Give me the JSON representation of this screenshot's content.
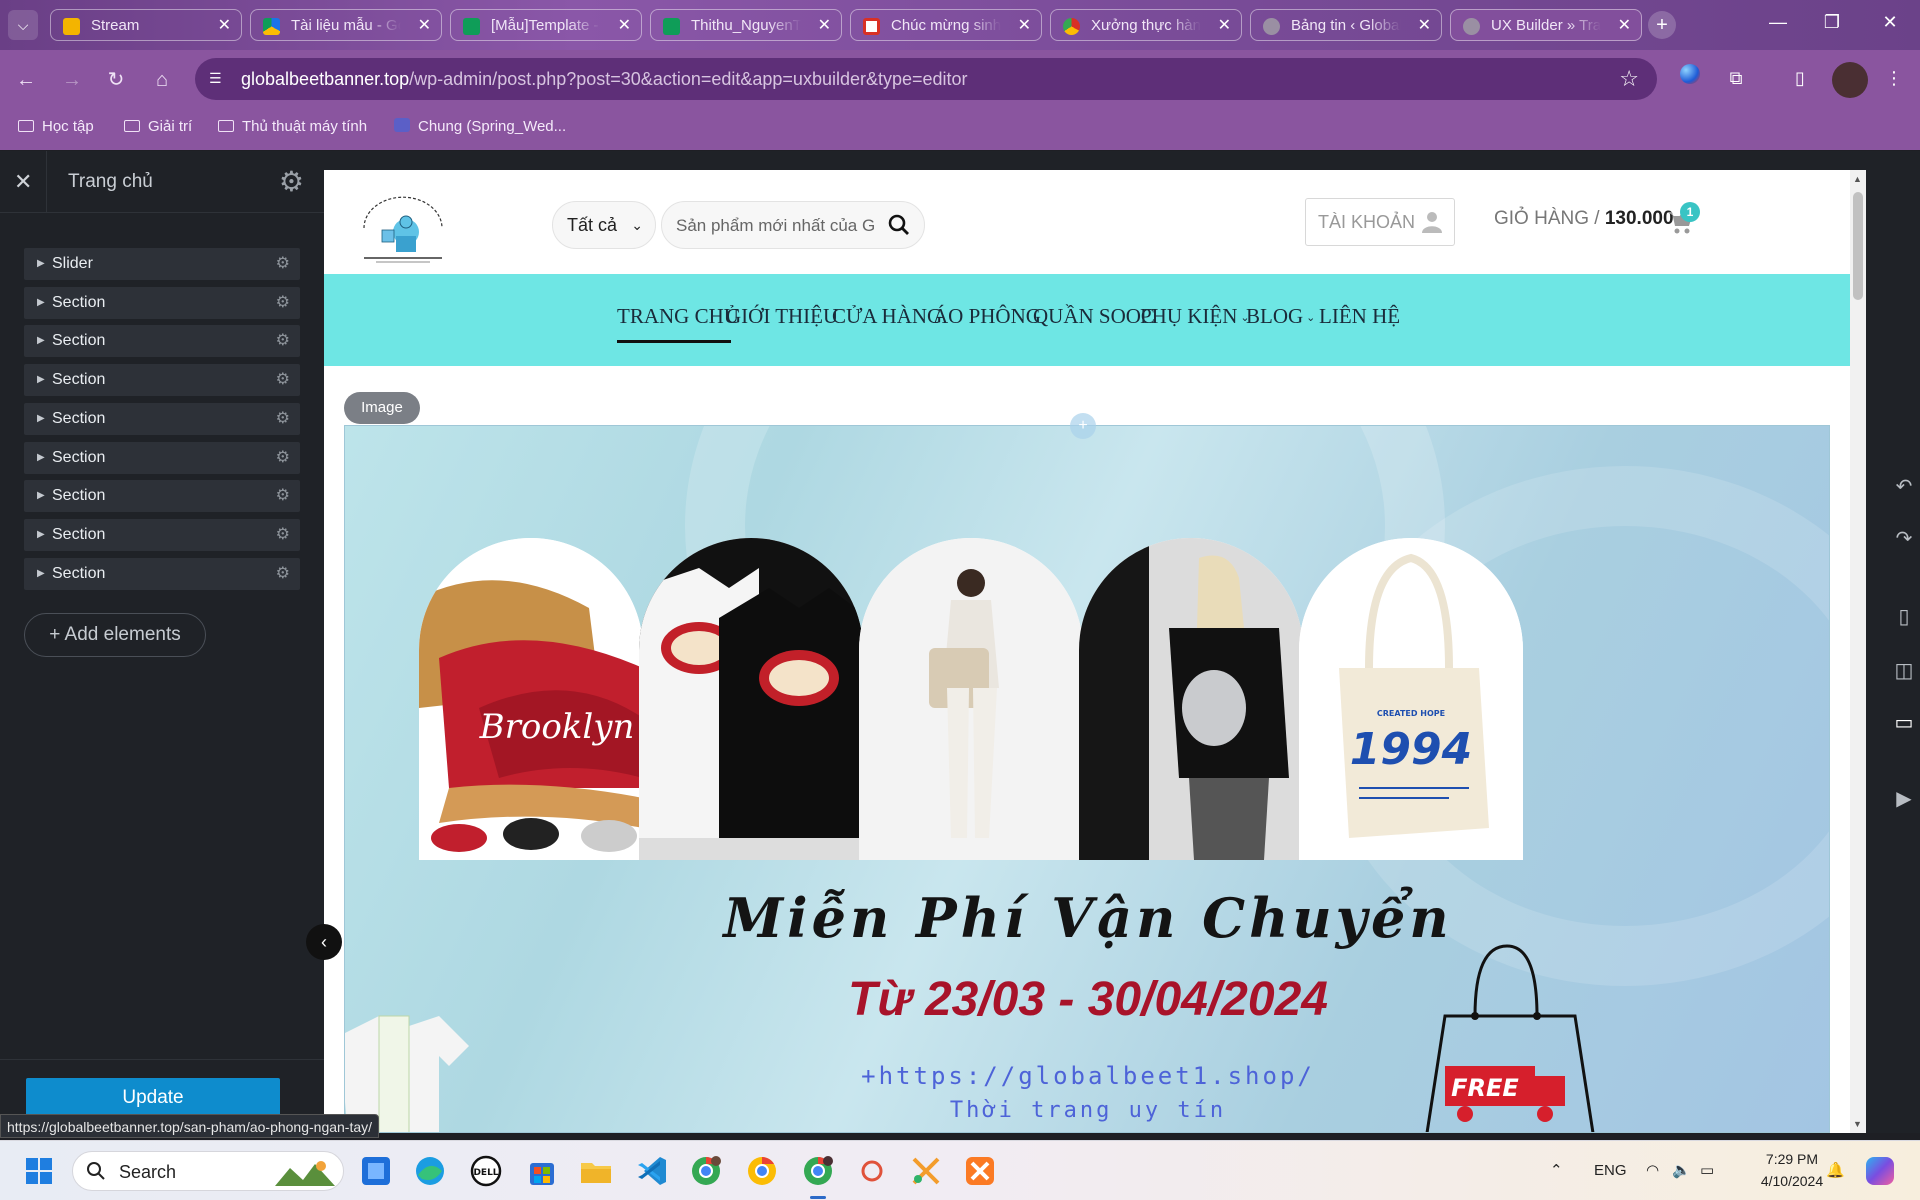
{
  "browser": {
    "tabs": [
      {
        "title": "Stream",
        "favicon_color": "#f4b400"
      },
      {
        "title": "Tài liệu mẫu - Go",
        "favicon_color": "#1a73e8"
      },
      {
        "title": "[Mẫu]Template -",
        "favicon_color": "#0f9d58"
      },
      {
        "title": "Thithu_NguyenTr",
        "favicon_color": "#0f9d58"
      },
      {
        "title": "Chúc mừng sinh",
        "favicon_color": "#d93025"
      },
      {
        "title": "Xưởng thực hàn",
        "favicon_color": "#34a853"
      },
      {
        "title": "Bảng tin ‹ Global",
        "favicon_color": "#6f6f6f"
      },
      {
        "title": "UX Builder » Tran",
        "favicon_color": "#6f6f6f"
      }
    ],
    "url_host": "globalbeetbanner.top",
    "url_path": "/wp-admin/post.php?post=30&action=edit&app=uxbuilder&type=editor",
    "bookmarks": [
      {
        "label": "Học tập"
      },
      {
        "label": "Giải trí"
      },
      {
        "label": "Thủ thuật máy tính"
      },
      {
        "label": "Chung (Spring_Wed..."
      }
    ],
    "status_url": "https://globalbeetbanner.top/san-pham/ao-phong-ngan-tay/"
  },
  "builder": {
    "page_title": "Trang chủ",
    "tree": [
      {
        "label": "Slider"
      },
      {
        "label": "Section"
      },
      {
        "label": "Section"
      },
      {
        "label": "Section"
      },
      {
        "label": "Section"
      },
      {
        "label": "Section"
      },
      {
        "label": "Section"
      },
      {
        "label": "Section"
      },
      {
        "label": "Section"
      }
    ],
    "add_elements_label": "+ Add elements",
    "update_label": "Update",
    "selected_element_label": "Image"
  },
  "site": {
    "category_select": "Tất cả",
    "search_placeholder": "Sản phẩm mới nhất của G",
    "account_label": "TÀI KHOẢN",
    "cart_label": "GIỎ HÀNG /",
    "cart_amount": "130.000",
    "cart_currency": "đ",
    "cart_count": "1",
    "nav": [
      {
        "label": "TRANG CHỦ",
        "active": true
      },
      {
        "label": "GIỚI THIỆU"
      },
      {
        "label": "CỬA HÀNG"
      },
      {
        "label": "ÁO PHÔNG"
      },
      {
        "label": "QUẦN SOOC"
      },
      {
        "label": "PHỤ KIỆN",
        "dropdown": true
      },
      {
        "label": "BLOG",
        "dropdown": true
      },
      {
        "label": "LIÊN HỆ"
      }
    ],
    "banner": {
      "title": "Miễn Phí Vận Chuyển",
      "dates": "Từ 23/03 - 30/04/2024",
      "url": "+https://globalbeet1.shop/",
      "tagline": "Thời trang uy tín",
      "products": [
        "cap-brooklyn",
        "tshirt-pair",
        "tote-model",
        "tshirt-model",
        "tote-1994"
      ],
      "tote_text": "1994",
      "tote_small_text": "CREATED HOPE",
      "truck_text": "FREE"
    },
    "colors": {
      "nav_bg": "#6ee6e4",
      "accent": "#39c4c4",
      "promo_red": "#a8132a",
      "promo_blue": "#4d63d8",
      "update_blue": "#0e8ccd"
    }
  },
  "taskbar": {
    "search_label": "Search",
    "language": "ENG",
    "time": "7:29 PM",
    "date": "4/10/2024"
  }
}
